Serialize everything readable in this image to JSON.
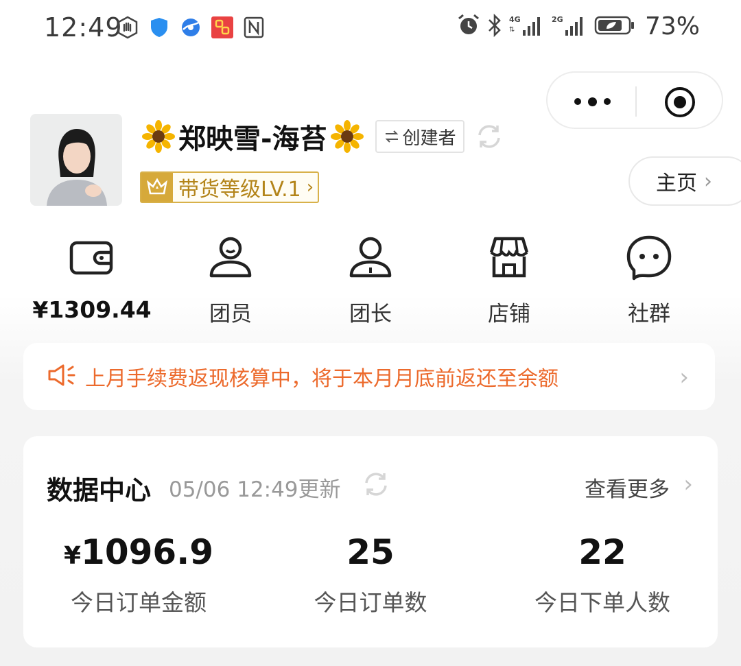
{
  "status_bar": {
    "time": "12:49",
    "battery": "73%",
    "left_icons": [
      "hand-shield-icon",
      "shield-icon",
      "globe-icon",
      "app-icon",
      "nfc-icon"
    ],
    "right_icons": [
      "alarm-icon",
      "bluetooth-icon",
      "signal-4g-icon",
      "signal-2g-icon",
      "battery-icon"
    ]
  },
  "profile": {
    "name": "郑映雪-海苔",
    "creator_badge": "创建者",
    "level": "带货等级LV.1",
    "home_button": "主页"
  },
  "functions": [
    {
      "label": "¥1309.44",
      "icon": "wallet-icon"
    },
    {
      "label": "团员",
      "icon": "member-icon"
    },
    {
      "label": "团长",
      "icon": "leader-icon"
    },
    {
      "label": "店铺",
      "icon": "store-icon"
    },
    {
      "label": "社群",
      "icon": "chat-icon"
    }
  ],
  "notice": {
    "text": "上月手续费返现核算中，将于本月月底前返还至余额",
    "icon": "speaker-icon"
  },
  "data_center": {
    "title": "数据中心",
    "updated": "05/06 12:49更新",
    "more": "查看更多",
    "stats": [
      {
        "currency": "¥",
        "value": "1096.9",
        "label": "今日订单金额"
      },
      {
        "value": "25",
        "label": "今日订单数"
      },
      {
        "value": "22",
        "label": "今日下单人数"
      }
    ]
  },
  "colors": {
    "accent_orange": "#ec6a2c",
    "level_gold": "#d6a93a"
  }
}
